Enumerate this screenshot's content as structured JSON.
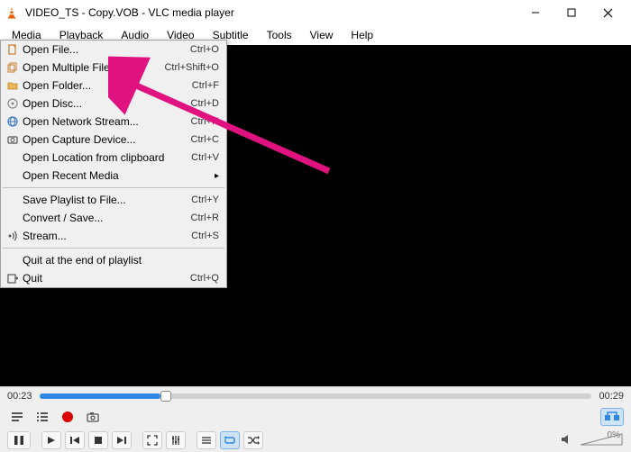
{
  "title": "VIDEO_TS - Copy.VOB - VLC media player",
  "menubar": [
    "Media",
    "Playback",
    "Audio",
    "Video",
    "Subtitle",
    "Tools",
    "View",
    "Help"
  ],
  "dropdown": {
    "groups": [
      [
        {
          "label": "Open File...",
          "shortcut": "Ctrl+O",
          "icon": "file"
        },
        {
          "label": "Open Multiple Files...",
          "shortcut": "Ctrl+Shift+O",
          "icon": "files"
        },
        {
          "label": "Open Folder...",
          "shortcut": "Ctrl+F",
          "icon": "folder"
        },
        {
          "label": "Open Disc...",
          "shortcut": "Ctrl+D",
          "icon": "disc"
        },
        {
          "label": "Open Network Stream...",
          "shortcut": "Ctrl+N",
          "icon": "network"
        },
        {
          "label": "Open Capture Device...",
          "shortcut": "Ctrl+C",
          "icon": "capture"
        },
        {
          "label": "Open Location from clipboard",
          "shortcut": "Ctrl+V",
          "icon": ""
        },
        {
          "label": "Open Recent Media",
          "shortcut": "",
          "icon": "",
          "submenu": true
        }
      ],
      [
        {
          "label": "Save Playlist to File...",
          "shortcut": "Ctrl+Y",
          "icon": ""
        },
        {
          "label": "Convert / Save...",
          "shortcut": "Ctrl+R",
          "icon": ""
        },
        {
          "label": "Stream...",
          "shortcut": "Ctrl+S",
          "icon": "stream"
        }
      ],
      [
        {
          "label": "Quit at the end of playlist",
          "shortcut": "",
          "icon": ""
        },
        {
          "label": "Quit",
          "shortcut": "Ctrl+Q",
          "icon": "quit"
        }
      ]
    ]
  },
  "time": {
    "current": "00:23",
    "total": "00:29"
  },
  "volume_pct": "0%"
}
